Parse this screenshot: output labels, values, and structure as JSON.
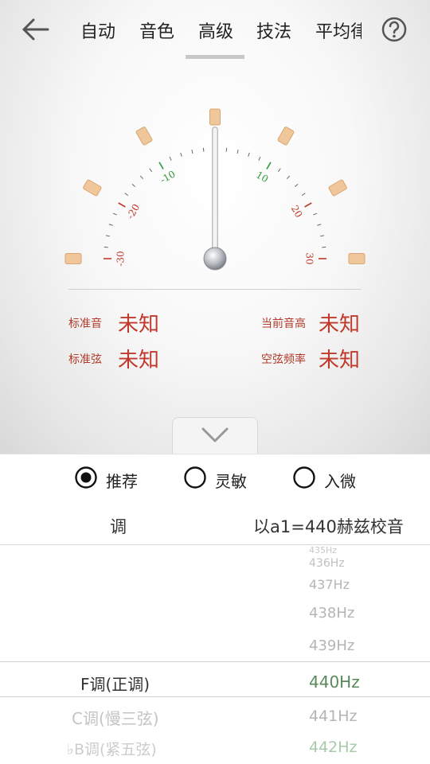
{
  "tabs": [
    "自动",
    "音色",
    "高级",
    "技法",
    "平均律"
  ],
  "info": {
    "std_pitch_label": "标准音",
    "std_pitch_value": "未知",
    "std_string_label": "标准弦",
    "std_string_value": "未知",
    "cur_pitch_label": "当前音高",
    "cur_pitch_value": "未知",
    "open_freq_label": "空弦频率",
    "open_freq_value": "未知"
  },
  "gauge": {
    "labels_left": [
      "-30",
      "-20",
      "-10"
    ],
    "labels_right": [
      "10",
      "20",
      "30"
    ],
    "needle_value": 0,
    "green_color": "#2e9a3a",
    "red_color": "#c0392b",
    "block_color": "#f0c79a"
  },
  "modes": [
    "推荐",
    "灵敏",
    "入微"
  ],
  "selected_mode": 0,
  "table_header": {
    "key": "调",
    "ref": "以a1=440赫兹校音"
  },
  "keys_below": [
    "C调(慢三弦)",
    "♭B调(紧五弦)"
  ],
  "selected_key": "F调(正调)",
  "hz_above": [
    "435Hz",
    "436Hz",
    "437Hz",
    "438Hz",
    "439Hz"
  ],
  "selected_hz": "440Hz",
  "hz_below": [
    "441Hz",
    "442Hz"
  ]
}
